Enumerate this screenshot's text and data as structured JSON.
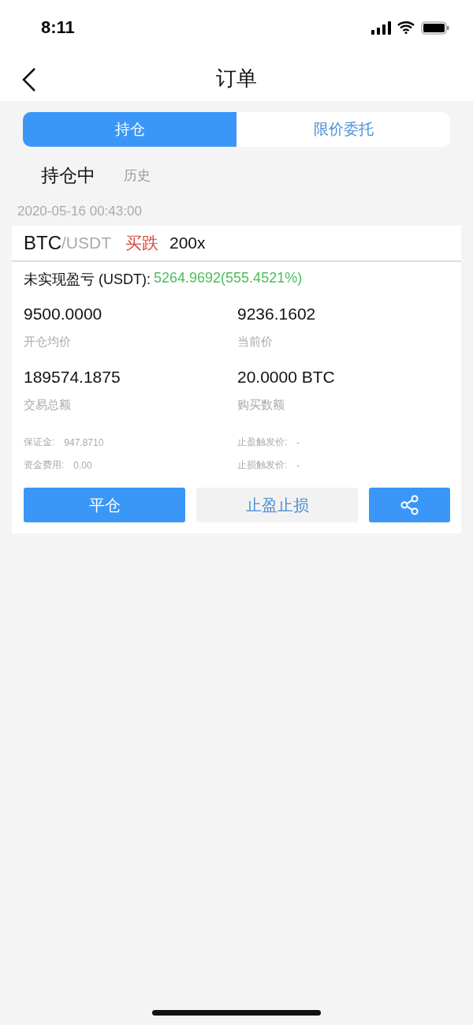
{
  "status_bar": {
    "time": "8:11"
  },
  "nav": {
    "title": "订单"
  },
  "tabs": [
    {
      "label": "持仓",
      "selected": true
    },
    {
      "label": "限价委托",
      "selected": false
    }
  ],
  "subtabs": [
    {
      "label": "持仓中",
      "selected": true
    },
    {
      "label": "历史",
      "selected": false
    }
  ],
  "orders": [
    {
      "time": "2020-05-16 00:43:00",
      "base": "BTC",
      "quote": "/USDT",
      "side": "买跌",
      "leverage": "200x",
      "pnl_label": "未实现盈亏 (USDT):",
      "pnl_value": "5264.9692(555.4521%)",
      "stats": [
        {
          "value": "9500.0000",
          "label": "开仓均价"
        },
        {
          "value": "9236.1602",
          "label": "当前价"
        },
        {
          "value": "189574.1875",
          "label": "交易总额"
        },
        {
          "value": "20.0000 BTC",
          "label": "购买数额"
        }
      ],
      "details": [
        {
          "label": "保证金:",
          "value": "947.8710"
        },
        {
          "label": "止盈触发价:",
          "value": "-"
        },
        {
          "label": "资金费用:",
          "value": "0.00"
        },
        {
          "label": "止损触发价:",
          "value": "-"
        }
      ],
      "buttons": [
        {
          "label": "平仓",
          "kind": "primary"
        },
        {
          "label": "止盈止损",
          "kind": "secondary"
        },
        {
          "kind": "share"
        }
      ]
    }
  ]
}
